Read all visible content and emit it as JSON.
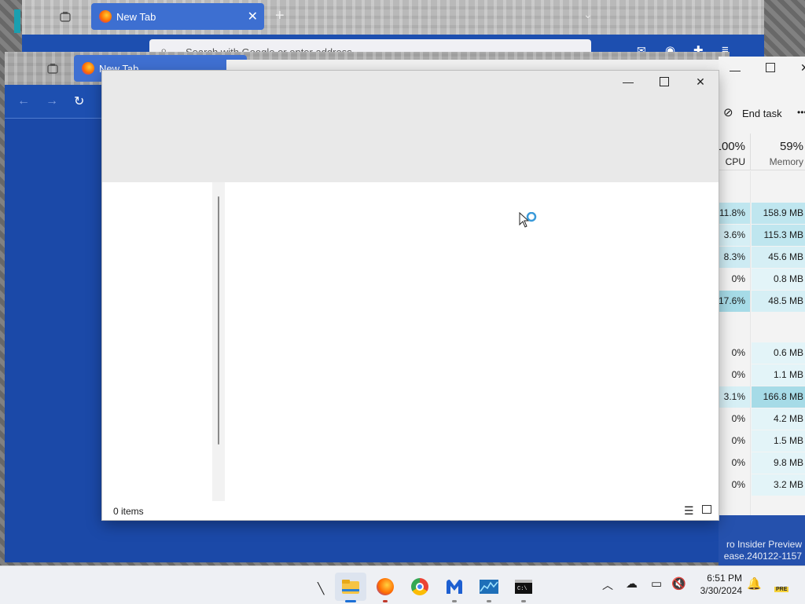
{
  "firefox_back": {
    "tab_title": "New Tab",
    "search_placeholder": "Search with Google or enter address"
  },
  "firefox_mid": {
    "tab_title": "New Tab"
  },
  "task_manager": {
    "end_task_label": "End task",
    "more_label": "•••",
    "cpu_percent": "100%",
    "cpu_label": "CPU",
    "memory_percent": "59%",
    "memory_label": "Memory",
    "rows": [
      {
        "cpu": "11.8%",
        "mem": "158.9 MB"
      },
      {
        "cpu": "3.6%",
        "mem": "115.3 MB"
      },
      {
        "cpu": "8.3%",
        "mem": "45.6 MB"
      },
      {
        "cpu": "0%",
        "mem": "0.8 MB"
      },
      {
        "cpu": "17.6%",
        "mem": "48.5 MB"
      },
      {
        "cpu": "0%",
        "mem": "0.6 MB"
      },
      {
        "cpu": "0%",
        "mem": "1.1 MB"
      },
      {
        "cpu": "3.1%",
        "mem": "166.8 MB"
      },
      {
        "cpu": "0%",
        "mem": "4.2 MB"
      },
      {
        "cpu": "0%",
        "mem": "1.5 MB"
      },
      {
        "cpu": "0%",
        "mem": "9.8 MB"
      },
      {
        "cpu": "0%",
        "mem": "3.2 MB"
      }
    ]
  },
  "explorer": {
    "status_text": "0 items"
  },
  "watermark": {
    "line1": "ro Insider Preview",
    "line2": "ease.240122-1157"
  },
  "taskbar": {
    "time": "6:51 PM",
    "date": "3/30/2024",
    "pre_badge": "PRE"
  },
  "colors": {
    "accent_blue": "#1b49a8",
    "tm_highlight": "#bfe6ef",
    "tm_highlight_strong": "#a6dbe7"
  }
}
